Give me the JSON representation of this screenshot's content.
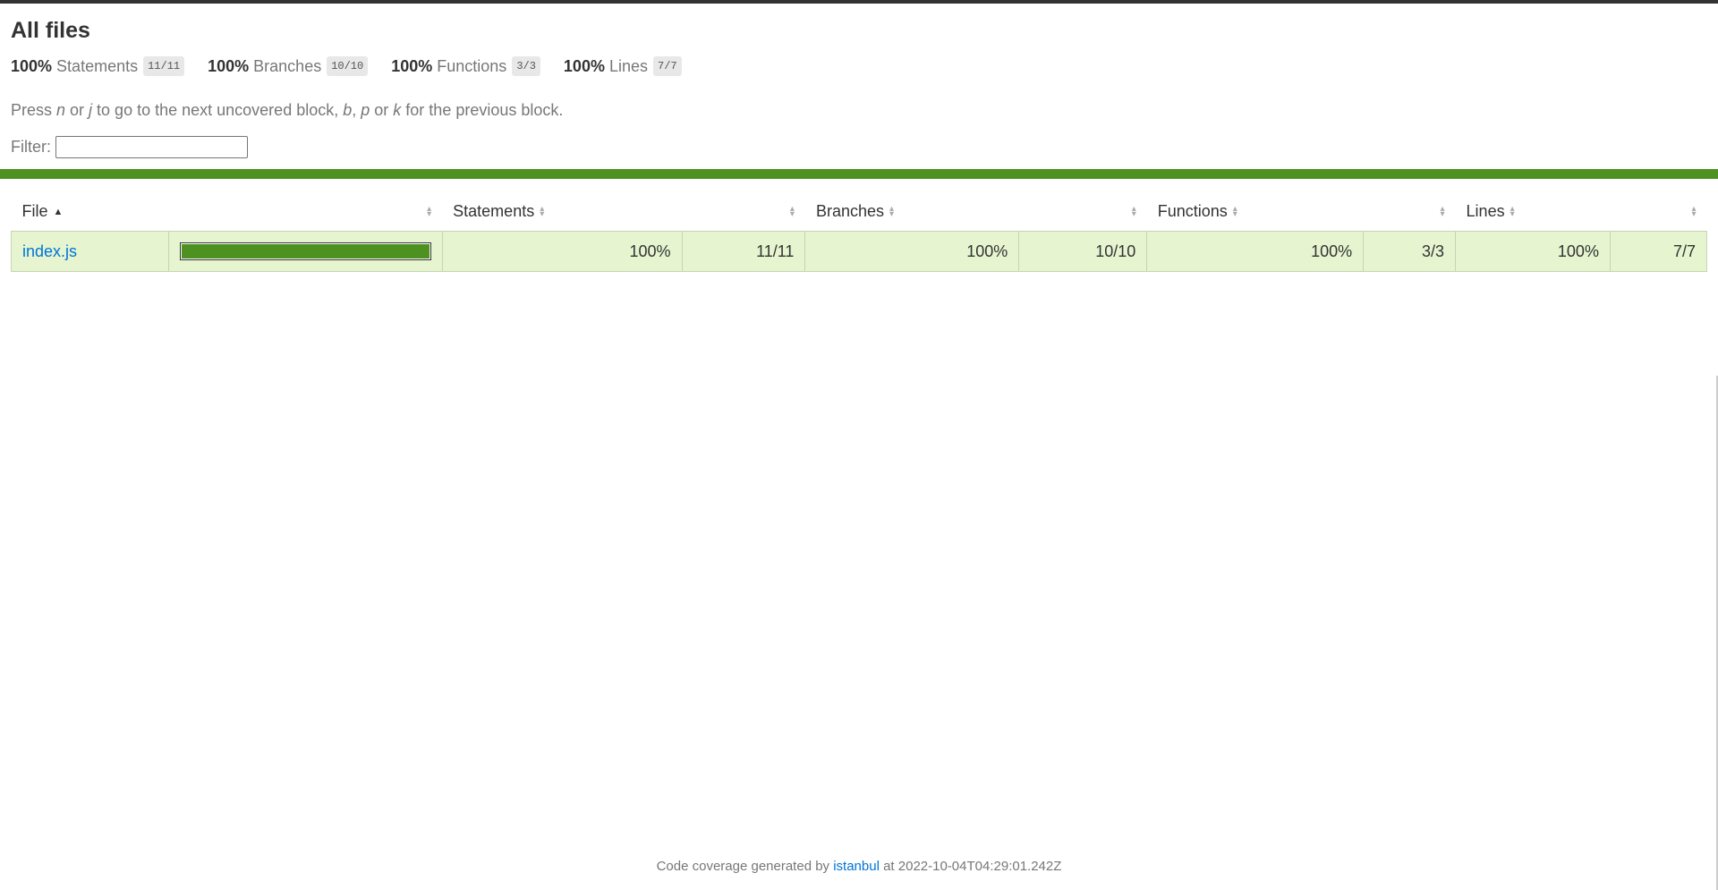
{
  "header": {
    "title": "All files"
  },
  "summary": [
    {
      "pct": "100%",
      "label": "Statements",
      "fraction": "11/11"
    },
    {
      "pct": "100%",
      "label": "Branches",
      "fraction": "10/10"
    },
    {
      "pct": "100%",
      "label": "Functions",
      "fraction": "3/3"
    },
    {
      "pct": "100%",
      "label": "Lines",
      "fraction": "7/7"
    }
  ],
  "hint": {
    "part1": "Press ",
    "n": "n",
    "part2": " or ",
    "j": "j",
    "part3": " to go to the next uncovered block, ",
    "b": "b",
    "part4": ", ",
    "p": "p",
    "part5": " or ",
    "k": "k",
    "part6": " for the previous block."
  },
  "filter": {
    "label": "Filter:",
    "value": "",
    "placeholder": ""
  },
  "colors": {
    "status_high": "#4d9221",
    "row_bg_high": "#e6f5d0",
    "link": "#0074d9"
  },
  "table": {
    "headers": {
      "file": "File",
      "statements": "Statements",
      "branches": "Branches",
      "functions": "Functions",
      "lines": "Lines"
    },
    "rows": [
      {
        "file": "index.js",
        "coverage_fraction": 1.0,
        "statements_pct": "100%",
        "statements_frac": "11/11",
        "branches_pct": "100%",
        "branches_frac": "10/10",
        "functions_pct": "100%",
        "functions_frac": "3/3",
        "lines_pct": "100%",
        "lines_frac": "7/7"
      }
    ]
  },
  "footer": {
    "prefix": "Code coverage generated by ",
    "link": "istanbul",
    "suffix": " at 2022-10-04T04:29:01.242Z"
  }
}
